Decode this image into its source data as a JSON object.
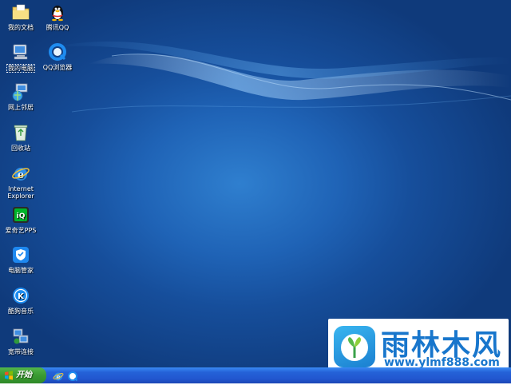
{
  "desktop": {
    "icons": [
      {
        "id": "my-documents",
        "label": "我的文档"
      },
      {
        "id": "tencent-qq",
        "label": "腾讯QQ"
      },
      {
        "id": "my-computer",
        "label": "我的电脑"
      },
      {
        "id": "qq-browser",
        "label": "QQ浏览器"
      },
      {
        "id": "network",
        "label": "网上邻居"
      },
      {
        "id": "recycle-bin",
        "label": "回收站"
      },
      {
        "id": "internet-explorer",
        "label_line1": "Internet",
        "label_line2": "Explorer"
      },
      {
        "id": "iqiyi",
        "label": "爱奇艺PPS"
      },
      {
        "id": "pc-manager",
        "label": "电脑管家"
      },
      {
        "id": "kugou",
        "label": "酷狗音乐"
      },
      {
        "id": "broadband",
        "label": "宽带连接"
      }
    ]
  },
  "watermark": {
    "title": "雨林木风",
    "url": "www.ylmf888.com",
    "brand_color": "#1876cc"
  },
  "taskbar": {
    "start_label": "开始",
    "quick_launch": [
      "ie-icon",
      "qq-browser-icon"
    ]
  },
  "colors": {
    "desktop_bg": "#164e9b",
    "taskbar": "#2257d0",
    "start_button": "#3a9a32"
  }
}
